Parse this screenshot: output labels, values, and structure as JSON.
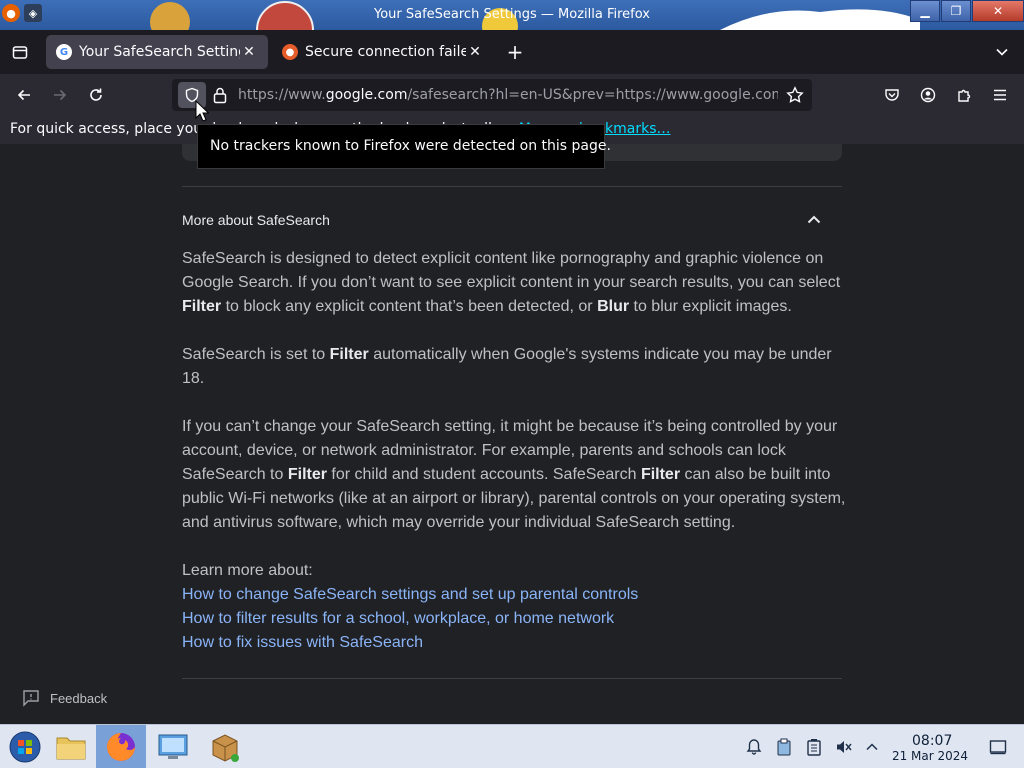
{
  "window": {
    "title": "Your SafeSearch Settings — Mozilla Firefox",
    "minimize_icon": "minimize-icon",
    "maximize_icon": "restore-icon",
    "close_icon": "close-icon"
  },
  "tabs": [
    {
      "label": "Your SafeSearch Setting",
      "favicon": "google-icon",
      "active": true
    },
    {
      "label": "Secure connection failed",
      "favicon": "firefox-icon",
      "active": false
    }
  ],
  "toolbar": {
    "url_prefix": "https://www.",
    "url_domain": "google.com",
    "url_rest": "/safesearch?hl=en-US&prev=https://www.google.com"
  },
  "bookmarks_bar": {
    "text": "For quick access, place your bookmarks here on the bookmarks toolbar.",
    "link": "Manage bookmarks…"
  },
  "tooltip": {
    "text": "No trackers known to Firefox were detected on this page."
  },
  "page": {
    "section_title": "More about SafeSearch",
    "p1_a": "SafeSearch is designed to detect explicit content like pornography and graphic violence on Google Search. If you don’t want to see explicit content in your search results, you can select ",
    "p1_filter": "Filter",
    "p1_b": " to block any explicit content that’s been detected, or ",
    "p1_blur": "Blur",
    "p1_c": " to blur explicit images.",
    "p2_a": "SafeSearch is set to ",
    "p2_filter": "Filter",
    "p2_b": " automatically when Google's systems indicate you may be under 18.",
    "p3_a": "If you can’t change your SafeSearch setting, it might be because it’s being controlled by your account, device, or network administrator. For example, parents and schools can lock SafeSearch to ",
    "p3_filter1": "Filter",
    "p3_b": " for child and student accounts. SafeSearch ",
    "p3_filter2": "Filter",
    "p3_c": " can also be built into public Wi-Fi networks (like at an airport or library), parental controls on your operating system, and antivirus software, which may override your individual SafeSearch setting.",
    "learn_more": "Learn more about:",
    "links": [
      "How to change SafeSearch settings and set up parental controls",
      "How to filter results for a school, workplace, or home network",
      "How to fix issues with SafeSearch"
    ],
    "feedback": "Feedback"
  },
  "taskbar": {
    "time": "08:07",
    "date": "21 Mar 2024",
    "apps": [
      "start-orb-icon",
      "file-manager-icon",
      "firefox-icon",
      "control-panel-icon",
      "package-installer-icon"
    ],
    "tray": [
      "notifications-icon",
      "clipboard-icon",
      "battery-icon",
      "volume-muted-icon",
      "tray-expand-icon",
      "show-desktop-icon"
    ]
  }
}
